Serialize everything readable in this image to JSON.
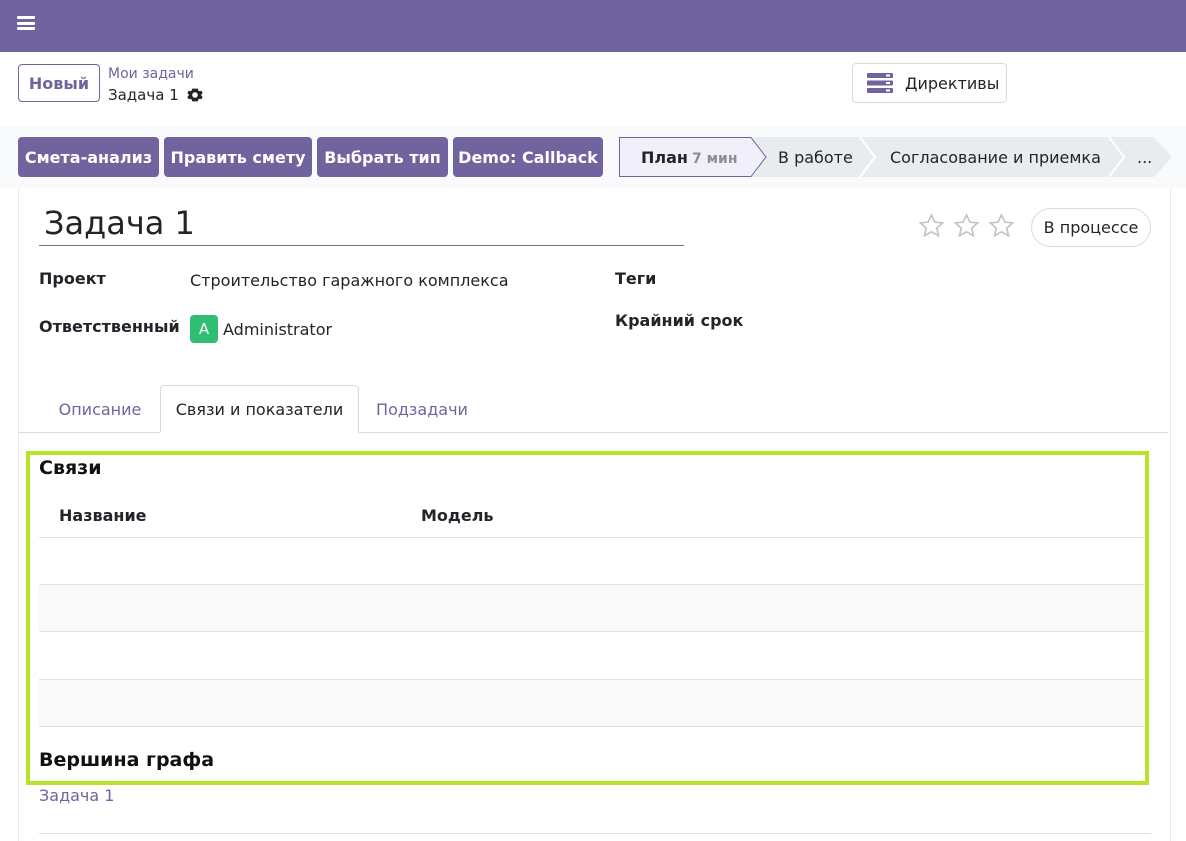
{
  "topbar": {
    "menu_icon": "hamburger-icon",
    "color": "#71639e"
  },
  "control": {
    "new_label": "Новый",
    "breadcrumb_parent": "Мои задачи",
    "breadcrumb_current": "Задача 1",
    "directives_label": "Директивы"
  },
  "actions": [
    "Смета-анализ",
    "Править смету",
    "Выбрать тип",
    "Demo: Callback"
  ],
  "stages": {
    "current": {
      "label": "План",
      "duration": "7 мин"
    },
    "others": [
      "В работе",
      "Согласование и приемка",
      "..."
    ]
  },
  "record": {
    "title": "Задача 1",
    "state": "В процессе",
    "stars": {
      "value": 0,
      "max": 3
    },
    "fields": {
      "project_label": "Проект",
      "project_value": "Строительство гаражного комплекса",
      "responsible_label": "Ответственный",
      "responsible_avatar": "A",
      "responsible_value": "Administrator",
      "tags_label": "Теги",
      "deadline_label": "Крайний срок"
    }
  },
  "tabs": [
    {
      "label": "Описание",
      "active": false
    },
    {
      "label": "Связи и показатели",
      "active": true
    },
    {
      "label": "Подзадачи",
      "active": false
    }
  ],
  "links_section": {
    "title": "Связи",
    "columns": [
      "Название",
      "Модель"
    ],
    "rows": []
  },
  "graph_section": {
    "title": "Вершина графа",
    "value": "Задача 1"
  },
  "colors": {
    "accent": "#71639e",
    "highlight": "#b7e32b",
    "avatar": "#2fbe73"
  }
}
